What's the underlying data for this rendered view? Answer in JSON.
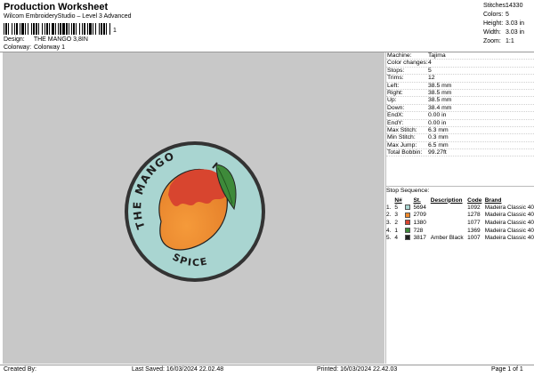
{
  "header": {
    "title": "Production Worksheet",
    "software": "Wilcom EmbroideryStudio – Level 3 Advanced",
    "barcode_suffix": "1"
  },
  "meta": {
    "design_label": "Design:",
    "design_value": "THE MANGO 3,8IN",
    "colorway_label": "Colorway:",
    "colorway_value": "Colorway 1"
  },
  "top_stats": [
    {
      "label": "Stitches:",
      "value": "14330"
    },
    {
      "label": "Colors:",
      "value": "5"
    },
    {
      "label": "Height:",
      "value": "3.03 in"
    },
    {
      "label": "Width:",
      "value": "3.03 in"
    },
    {
      "label": "Zoom:",
      "value": "1:1"
    }
  ],
  "info": [
    {
      "label": "Machine:",
      "value": "Tajima"
    },
    {
      "label": "Color changes:",
      "value": "4"
    },
    {
      "label": "Stops:",
      "value": "5"
    },
    {
      "label": "Trims:",
      "value": "12"
    },
    {
      "label": "Left:",
      "value": "38.5 mm"
    },
    {
      "label": "Right:",
      "value": "38.5 mm"
    },
    {
      "label": "Up:",
      "value": "38.5 mm"
    },
    {
      "label": "Down:",
      "value": "38.4 mm"
    },
    {
      "label": "EndX:",
      "value": "0.00 in"
    },
    {
      "label": "EndY:",
      "value": "0.00 in"
    },
    {
      "label": "Max Stitch:",
      "value": "6.3 mm"
    },
    {
      "label": "Min Stitch:",
      "value": "0.3 mm"
    },
    {
      "label": "Max Jump:",
      "value": "6.5 mm"
    },
    {
      "label": "Total Bobbin:",
      "value": "99.27ft"
    }
  ],
  "stop_sequence": {
    "title": "Stop Sequence:",
    "headers": {
      "num": "N#",
      "st": "St.",
      "description": "Description",
      "code": "Code",
      "brand": "Brand"
    },
    "rows": [
      {
        "stop": "1.",
        "num": "5",
        "color": "#a9d5d1",
        "st": "5694",
        "description": "",
        "code": "1092",
        "brand": "Madeira Classic 40"
      },
      {
        "stop": "2.",
        "num": "3",
        "color": "#f08a2c",
        "st": "2709",
        "description": "",
        "code": "1278",
        "brand": "Madeira Classic 40"
      },
      {
        "stop": "3.",
        "num": "2",
        "color": "#d8452f",
        "st": "1380",
        "description": "",
        "code": "1077",
        "brand": "Madeira Classic 40"
      },
      {
        "stop": "4.",
        "num": "1",
        "color": "#3e8a3a",
        "st": "728",
        "description": "",
        "code": "1369",
        "brand": "Madeira Classic 40"
      },
      {
        "stop": "5.",
        "num": "4",
        "color": "#1f1f1f",
        "st": "3817",
        "description": "Amber Black",
        "code": "1007",
        "brand": "Madeira Classic 40"
      }
    ]
  },
  "design_art": {
    "text_top": "THE MANGO",
    "text_bottom": "SPICE"
  },
  "footer": {
    "created_by": "Created By:",
    "last_saved": "Last Saved: 16/03/2024 22.02.48",
    "printed": "Printed: 16/03/2024 22.42.03",
    "page": "Page 1 of 1"
  },
  "colors": {
    "canvas": "#c8c8c8",
    "patch_fill": "#a9d5d1",
    "patch_border": "#333333",
    "mango_orange": "#f08a2c",
    "mango_red": "#d8452f",
    "leaf_green": "#3e8a3a"
  }
}
